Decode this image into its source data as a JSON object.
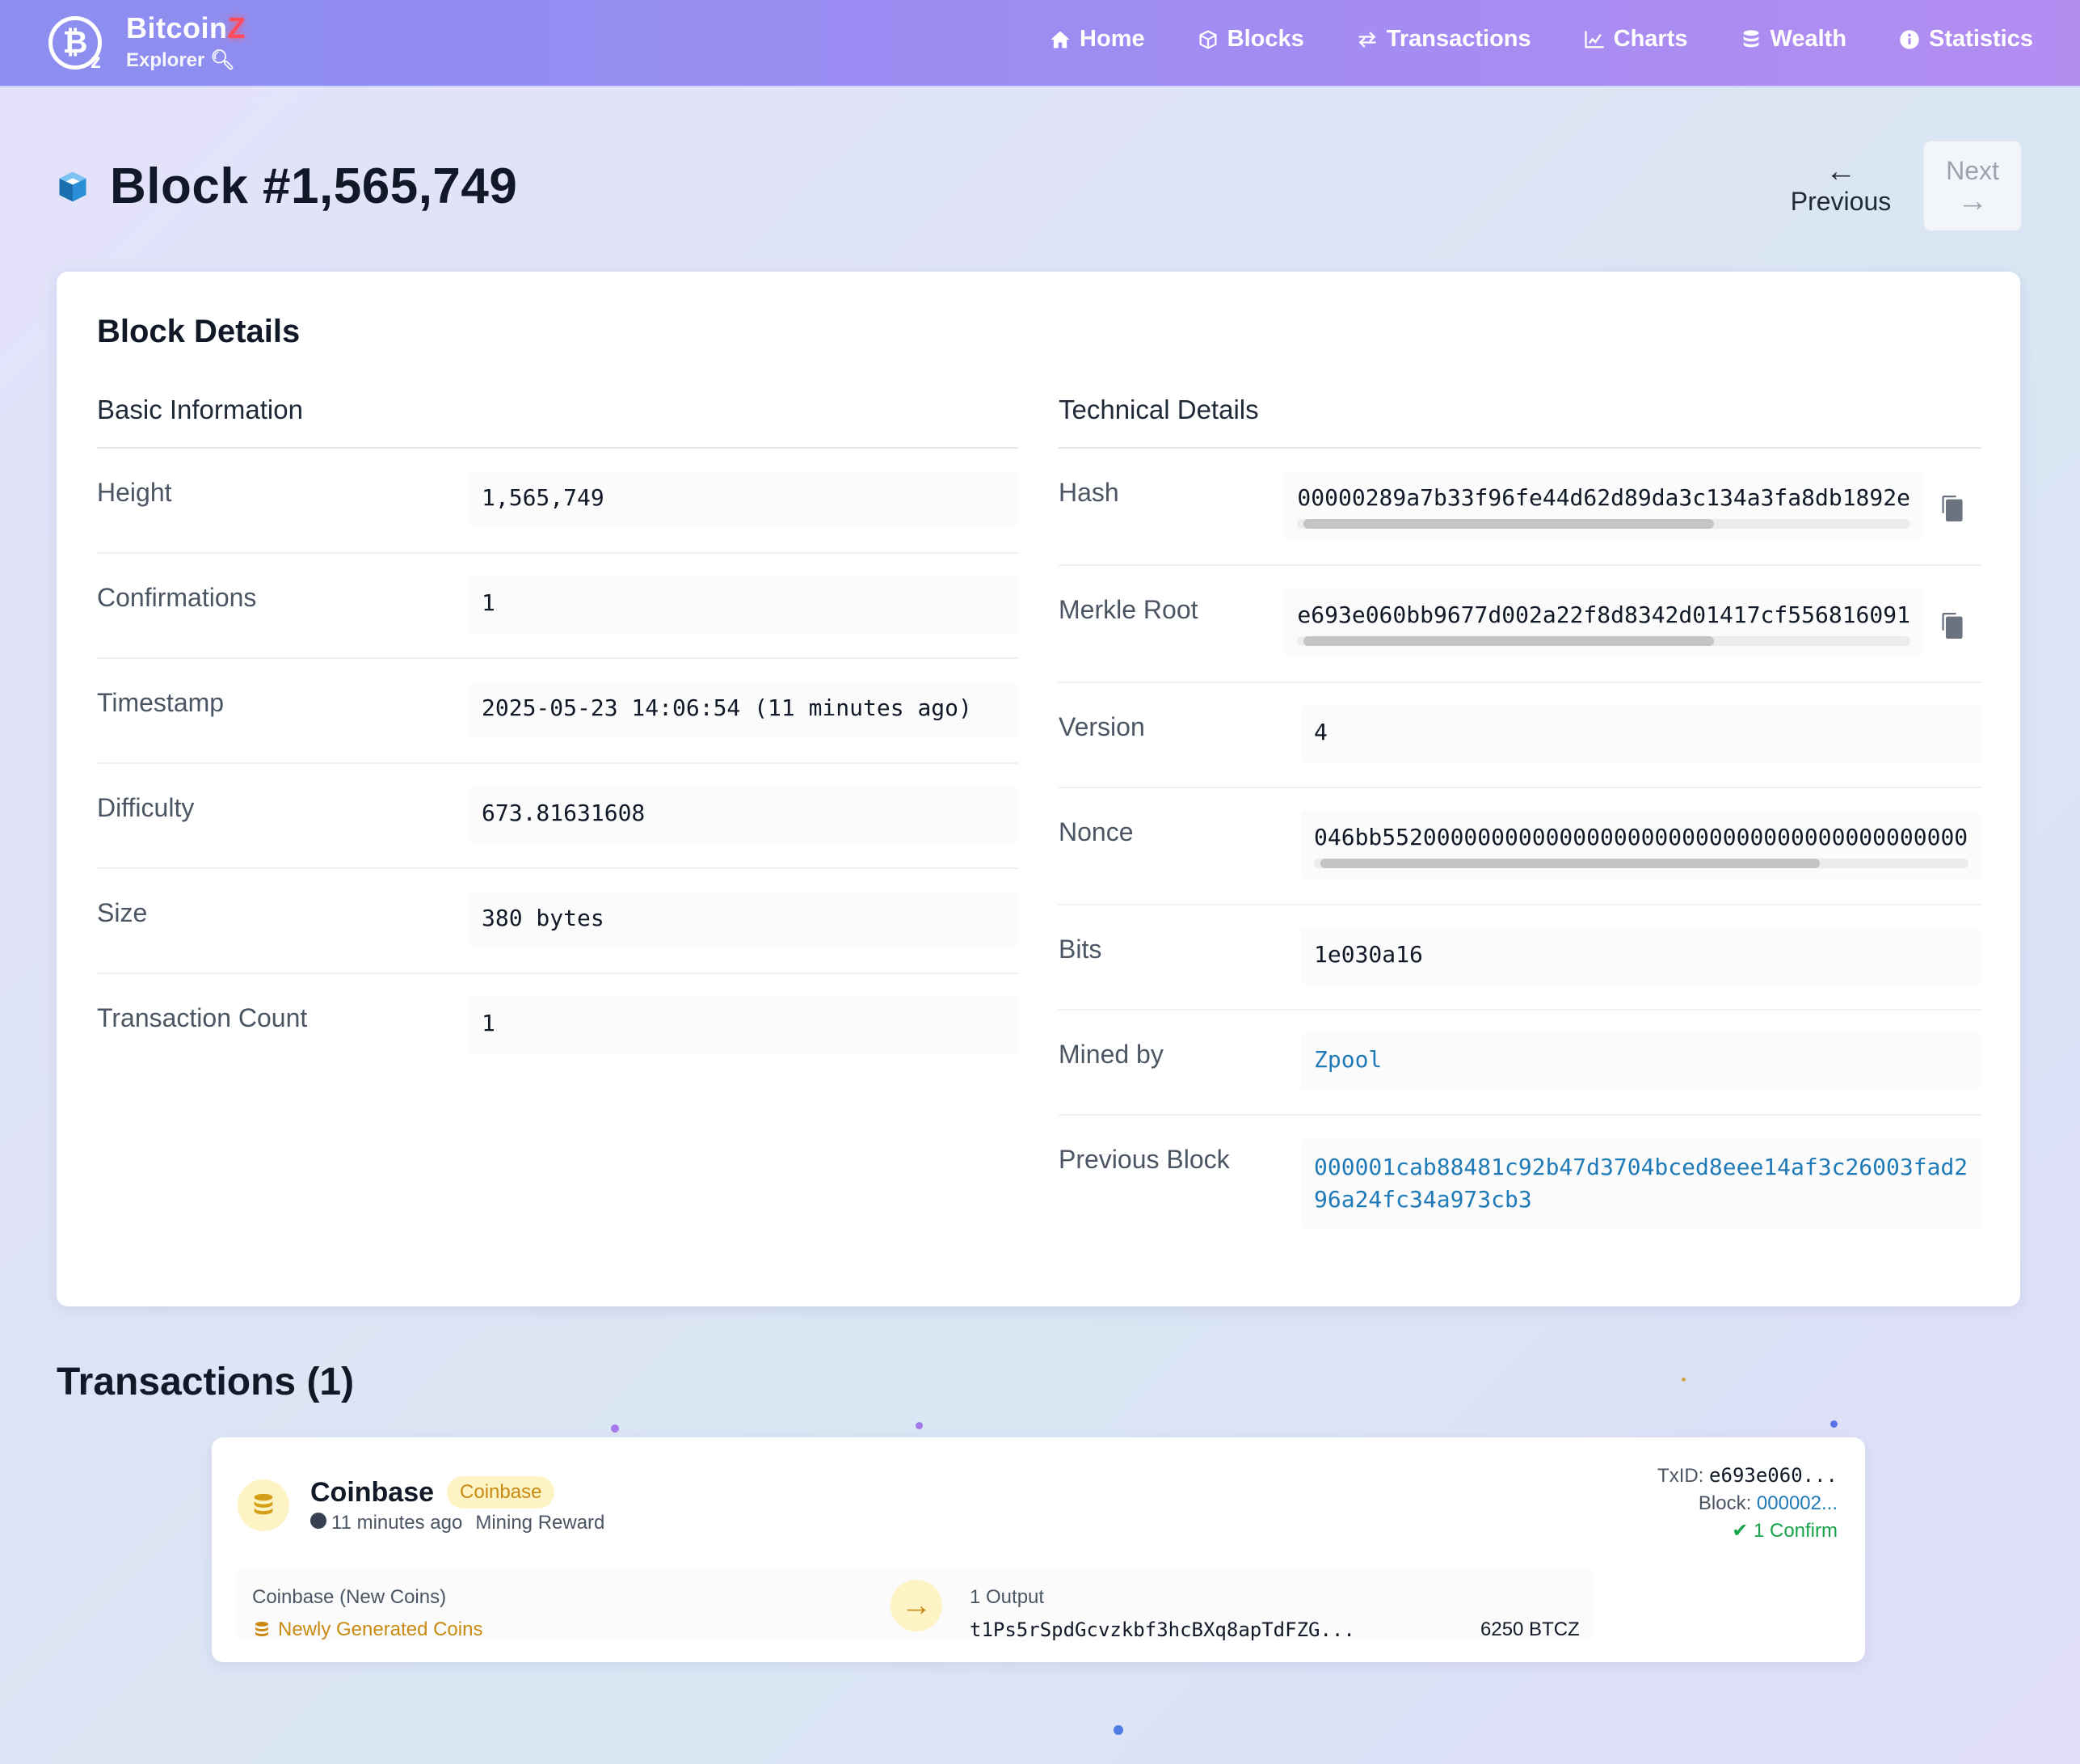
{
  "brand": {
    "title": "Bitcoin",
    "title_badge": "Z",
    "subtitle": "Explorer"
  },
  "nav": [
    {
      "label": "Home",
      "icon": "home-icon"
    },
    {
      "label": "Blocks",
      "icon": "cube-icon"
    },
    {
      "label": "Transactions",
      "icon": "exchange-icon"
    },
    {
      "label": "Charts",
      "icon": "chart-icon"
    },
    {
      "label": "Wealth",
      "icon": "coins-icon"
    },
    {
      "label": "Statistics",
      "icon": "info-icon"
    }
  ],
  "page": {
    "title": "Block #1,565,749"
  },
  "pager": {
    "prev_label": "Previous",
    "next_label": "Next"
  },
  "details": {
    "title": "Block Details",
    "basic": {
      "heading": "Basic Information",
      "rows": [
        {
          "label": "Height",
          "value": "1,565,749"
        },
        {
          "label": "Confirmations",
          "value": "1"
        },
        {
          "label": "Timestamp",
          "value": "2025-05-23 14:06:54 (11 minutes ago)"
        },
        {
          "label": "Difficulty",
          "value": "673.81631608"
        },
        {
          "label": "Size",
          "value": "380 bytes"
        },
        {
          "label": "Transaction Count",
          "value": "1"
        }
      ]
    },
    "technical": {
      "heading": "Technical Details",
      "hash": {
        "label": "Hash",
        "value": "00000289a7b33f96fe44d62d89da3c134a3fa8db1892e"
      },
      "merkle": {
        "label": "Merkle Root",
        "value": "e693e060bb9677d002a22f8d8342d01417cf556816091"
      },
      "version": {
        "label": "Version",
        "value": "4"
      },
      "nonce": {
        "label": "Nonce",
        "value": "046bb5520000000000000000000000000000000000000000"
      },
      "bits": {
        "label": "Bits",
        "value": "1e030a16"
      },
      "mined_by": {
        "label": "Mined by",
        "value": "Zpool"
      },
      "previous_block": {
        "label": "Previous Block",
        "value": "000001cab88481c92b47d3704bced8eee14af3c26003fad296a24fc34a973cb3"
      }
    }
  },
  "transactions": {
    "title": "Transactions (1)",
    "items": [
      {
        "name": "Coinbase",
        "badge": "Coinbase",
        "time": "11 minutes ago",
        "type": "Mining Reward",
        "txid_label": "TxID:",
        "txid": "e693e060...",
        "block_label": "Block:",
        "block": "000002...",
        "confirm": "✔ 1 Confirm",
        "input_title": "Coinbase (New Coins)",
        "input_sub": "Newly Generated Coins",
        "output_title": "1 Output",
        "output_address": "t1Ps5rSpdGcvzkbf3hcBXq8apTdFZG...",
        "output_amount": "6250 BTCZ"
      }
    ]
  },
  "colors": {
    "nav_gradient_start": "#8b8ef0",
    "nav_gradient_end": "#b48df1",
    "link": "#1f7ab8",
    "coin_accent": "#c88a12",
    "confirm_green": "#16a34a"
  }
}
